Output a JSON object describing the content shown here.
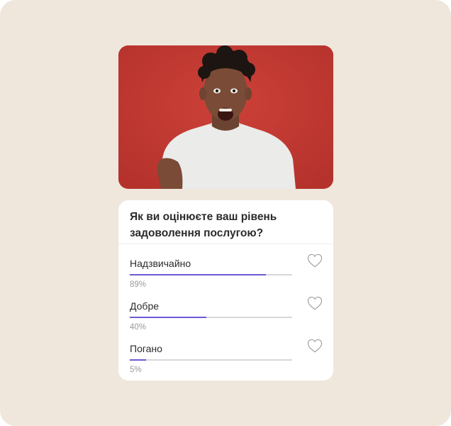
{
  "poll": {
    "question": "Як ви оцінюєте ваш рівень задоволення послугою?",
    "accent_color": "#6b5bd3",
    "options": [
      {
        "label": "Надзвичайно",
        "percent_text": "89%",
        "fill_fraction": 0.84
      },
      {
        "label": "Добре",
        "percent_text": "40%",
        "fill_fraction": 0.47
      },
      {
        "label": "Погано",
        "percent_text": "5%",
        "fill_fraction": 0.1
      }
    ]
  }
}
